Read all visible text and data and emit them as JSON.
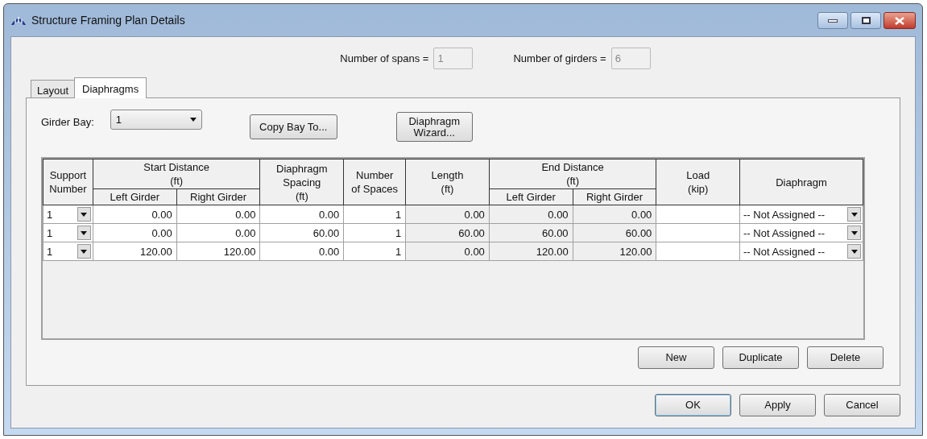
{
  "window": {
    "title": "Structure Framing Plan Details"
  },
  "header_fields": [
    {
      "label": "Number of spans =",
      "value": "1",
      "disabled": true
    },
    {
      "label": "Number of girders =",
      "value": "6",
      "disabled": true
    }
  ],
  "tabs": [
    {
      "label": "Layout",
      "selected": false
    },
    {
      "label": "Diaphragms",
      "selected": true
    }
  ],
  "girder_bay": {
    "label": "Girder Bay:",
    "value": "1"
  },
  "top_buttons": [
    "Copy Bay To...",
    "Diaphragm\nWizard..."
  ],
  "table": {
    "header_groups": [
      {
        "label": "Support\nNumber"
      },
      {
        "label": "Start Distance\n(ft)",
        "sub": [
          "Left Girder",
          "Right Girder"
        ]
      },
      {
        "label": "Diaphragm\nSpacing\n(ft)"
      },
      {
        "label": "Number\nof Spaces"
      },
      {
        "label": "Length\n(ft)"
      },
      {
        "label": "End Distance\n(ft)",
        "sub": [
          "Left Girder",
          "Right Girder"
        ]
      },
      {
        "label": "Load\n(kip)"
      },
      {
        "label": "Diaphragm"
      }
    ],
    "rows": [
      [
        {
          "kind": "combo",
          "text": "1"
        },
        {
          "kind": "edit",
          "text": "0.00"
        },
        {
          "kind": "edit",
          "text": "0.00"
        },
        {
          "kind": "edit",
          "text": "0.00"
        },
        {
          "kind": "edit",
          "text": "1"
        },
        {
          "kind": "computed",
          "text": "0.00"
        },
        {
          "kind": "computed",
          "text": "0.00"
        },
        {
          "kind": "computed",
          "text": "0.00"
        },
        {
          "kind": "edit"
        },
        {
          "kind": "combo",
          "text": "-- Not Assigned --"
        }
      ],
      [
        {
          "kind": "combo",
          "text": "1"
        },
        {
          "kind": "edit",
          "text": "0.00"
        },
        {
          "kind": "edit",
          "text": "0.00"
        },
        {
          "kind": "edit",
          "text": "60.00"
        },
        {
          "kind": "edit",
          "text": "1"
        },
        {
          "kind": "computed",
          "text": "60.00"
        },
        {
          "kind": "computed",
          "text": "60.00"
        },
        {
          "kind": "computed",
          "text": "60.00"
        },
        {
          "kind": "edit"
        },
        {
          "kind": "combo",
          "text": "-- Not Assigned --"
        }
      ],
      [
        {
          "kind": "combo",
          "text": "1"
        },
        {
          "kind": "edit",
          "text": "120.00"
        },
        {
          "kind": "edit",
          "text": "120.00"
        },
        {
          "kind": "edit",
          "text": "0.00"
        },
        {
          "kind": "edit",
          "text": "1"
        },
        {
          "kind": "computed",
          "text": "0.00"
        },
        {
          "kind": "computed",
          "text": "120.00"
        },
        {
          "kind": "computed",
          "text": "120.00"
        },
        {
          "kind": "edit"
        },
        {
          "kind": "combo",
          "text": "-- Not Assigned --"
        }
      ]
    ]
  },
  "grid_buttons": [
    "New",
    "Duplicate",
    "Delete"
  ],
  "dialog_buttons": [
    {
      "label": "OK",
      "default": true
    },
    {
      "label": "Apply",
      "default": false
    },
    {
      "label": "Cancel",
      "default": false
    }
  ]
}
